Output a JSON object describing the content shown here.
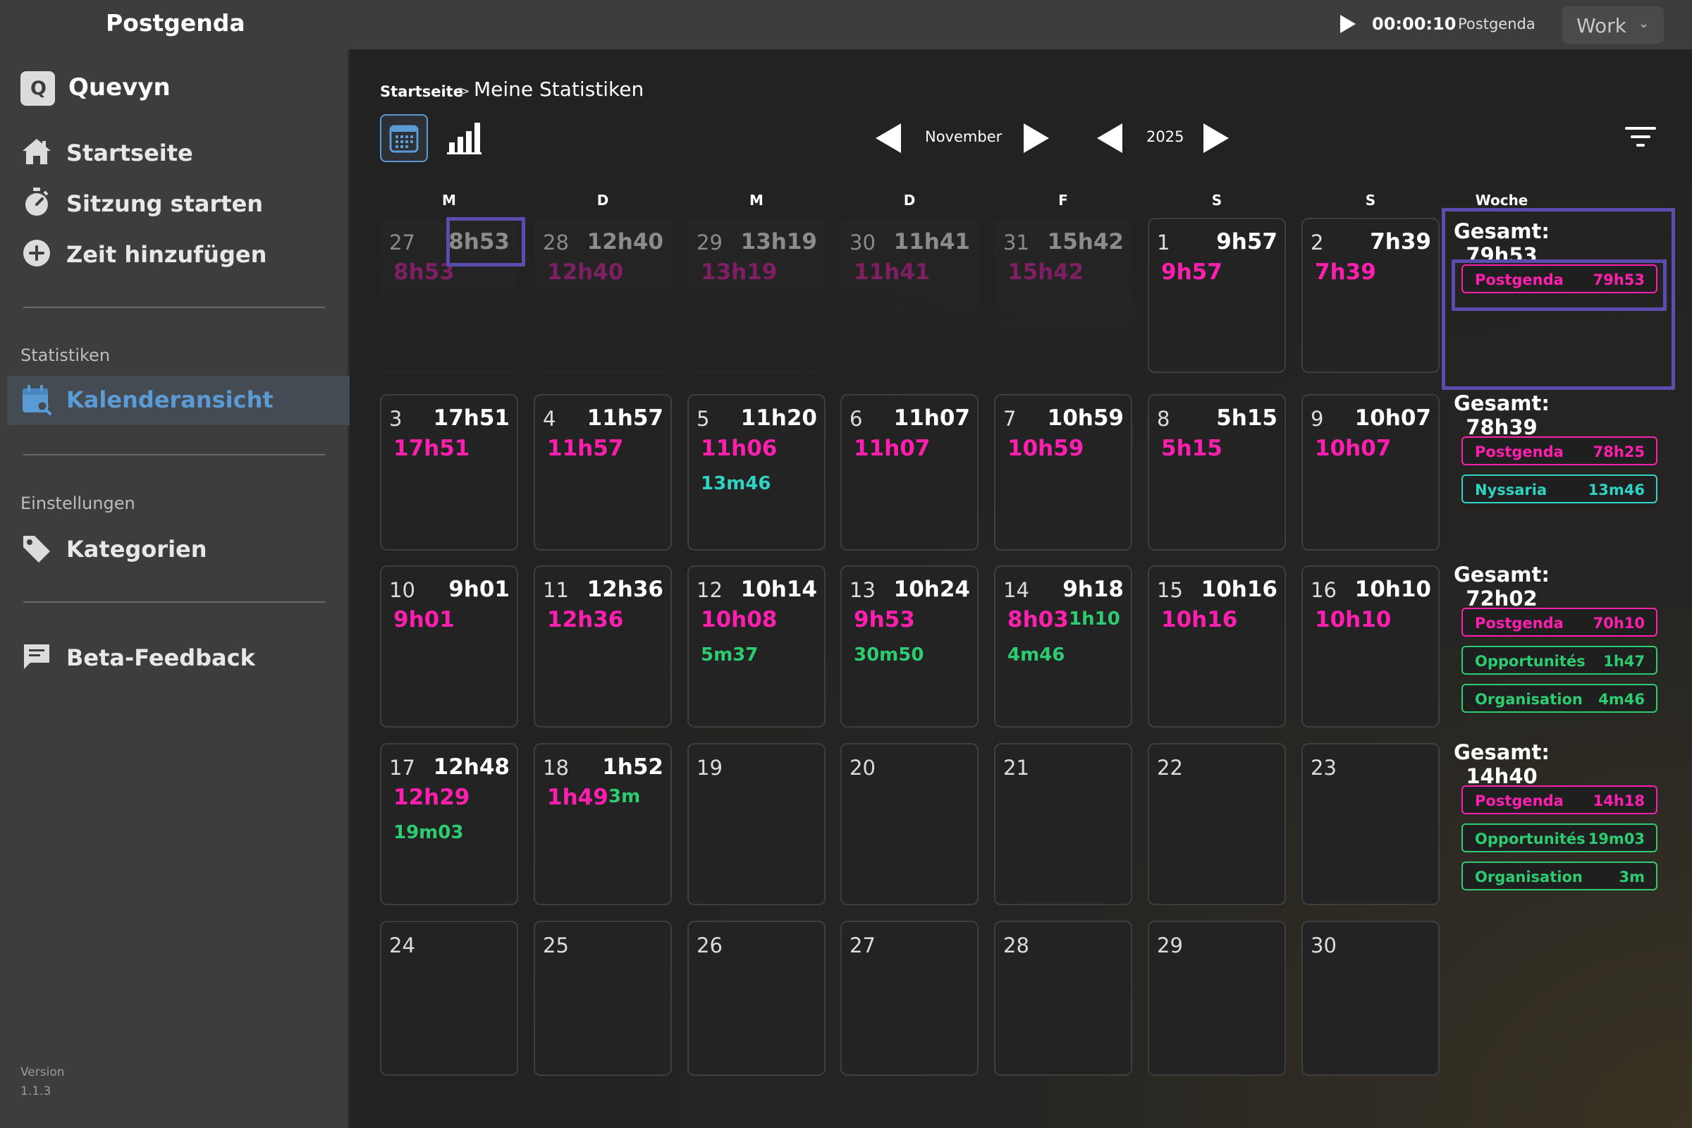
{
  "topbar": {
    "app_title": "Postgenda",
    "timer_time": "00:00:10",
    "timer_project": "Postgenda",
    "workspace": "Work"
  },
  "sidebar": {
    "brand_letter": "Q",
    "brand_name": "Quevyn",
    "nav": [
      "Startseite",
      "Sitzung starten",
      "Zeit hinzufügen"
    ],
    "section_stats": "Statistiken",
    "active_item": "Kalenderansicht",
    "section_settings": "Einstellungen",
    "settings_item": "Kategorien",
    "feedback_item": "Beta-Feedback",
    "version_label": "Version",
    "version_value": "1.1.3"
  },
  "main": {
    "breadcrumb_home": "Startseite",
    "breadcrumb_sep": ">",
    "breadcrumb_current": "Meine Statistiken",
    "month": "November",
    "year": "2025",
    "weekday_headers": [
      "M",
      "D",
      "M",
      "D",
      "F",
      "S",
      "S"
    ],
    "week_header": "Woche"
  },
  "calendar": {
    "rows": [
      [
        {
          "day": "27",
          "total": "8h53",
          "e1": "8h53",
          "outside": true
        },
        {
          "day": "28",
          "total": "12h40",
          "e1": "12h40",
          "outside": true
        },
        {
          "day": "29",
          "total": "13h19",
          "e1": "13h19",
          "outside": true
        },
        {
          "day": "30",
          "total": "11h41",
          "e1": "11h41",
          "outside": true
        },
        {
          "day": "31",
          "total": "15h42",
          "e1": "15h42",
          "outside": true
        },
        {
          "day": "1",
          "total": "9h57",
          "e1": "9h57"
        },
        {
          "day": "2",
          "total": "7h39",
          "e1": "7h39"
        }
      ],
      [
        {
          "day": "3",
          "total": "17h51",
          "e1": "17h51"
        },
        {
          "day": "4",
          "total": "11h57",
          "e1": "11h57"
        },
        {
          "day": "5",
          "total": "11h20",
          "e1": "11h06",
          "e2": "13m46",
          "e2color": "#2ed3c4",
          "e2pos": "below"
        },
        {
          "day": "6",
          "total": "11h07",
          "e1": "11h07"
        },
        {
          "day": "7",
          "total": "10h59",
          "e1": "10h59"
        },
        {
          "day": "8",
          "total": "5h15",
          "e1": "5h15"
        },
        {
          "day": "9",
          "total": "10h07",
          "e1": "10h07"
        }
      ],
      [
        {
          "day": "10",
          "total": "9h01",
          "e1": "9h01"
        },
        {
          "day": "11",
          "total": "12h36",
          "e1": "12h36"
        },
        {
          "day": "12",
          "total": "10h14",
          "e1": "10h08",
          "e2": "5m37",
          "e2color": "#2ecc71",
          "e2pos": "below"
        },
        {
          "day": "13",
          "total": "10h24",
          "e1": "9h53",
          "e2": "30m50",
          "e2color": "#2ecc71",
          "e2pos": "below"
        },
        {
          "day": "14",
          "total": "9h18",
          "e1": "8h03",
          "e2": "1h10",
          "e2color": "#2ecc71",
          "e2pos": "inline",
          "e3": "4m46",
          "e3color": "#2ecc71"
        },
        {
          "day": "15",
          "total": "10h16",
          "e1": "10h16"
        },
        {
          "day": "16",
          "total": "10h10",
          "e1": "10h10"
        }
      ],
      [
        {
          "day": "17",
          "total": "12h48",
          "e1": "12h29",
          "e2": "19m03",
          "e2color": "#2ecc71",
          "e2pos": "below"
        },
        {
          "day": "18",
          "total": "1h52",
          "e1": "1h49",
          "e2": "3m",
          "e2color": "#2ecc71",
          "e2pos": "inline"
        },
        {
          "day": "19"
        },
        {
          "day": "20"
        },
        {
          "day": "21"
        },
        {
          "day": "22"
        },
        {
          "day": "23"
        }
      ],
      [
        {
          "day": "24"
        },
        {
          "day": "25"
        },
        {
          "day": "26"
        },
        {
          "day": "27"
        },
        {
          "day": "28"
        },
        {
          "day": "29"
        },
        {
          "day": "30"
        }
      ]
    ]
  },
  "weeks": [
    {
      "total": "Gesamt: 79h53",
      "chips": [
        {
          "name": "Postgenda",
          "value": "79h53",
          "kind": "pg"
        }
      ]
    },
    {
      "total": "Gesamt: 78h39",
      "chips": [
        {
          "name": "Postgenda",
          "value": "78h25",
          "kind": "pg"
        },
        {
          "name": "Nyssaria",
          "value": "13m46",
          "kind": "ny"
        }
      ]
    },
    {
      "total": "Gesamt: 72h02",
      "chips": [
        {
          "name": "Postgenda",
          "value": "70h10",
          "kind": "pg"
        },
        {
          "name": "Opportunités",
          "value": "1h47",
          "kind": "op"
        },
        {
          "name": "Organisation",
          "value": "4m46",
          "kind": "op"
        }
      ]
    },
    {
      "total": "Gesamt: 14h40",
      "chips": [
        {
          "name": "Postgenda",
          "value": "14h18",
          "kind": "pg"
        },
        {
          "name": "Opportunités",
          "value": "19m03",
          "kind": "op"
        },
        {
          "name": "Organisation",
          "value": "3m",
          "kind": "op"
        }
      ]
    }
  ],
  "colors": {
    "postgenda": "#ff1faf",
    "opportunites": "#2ecc71",
    "nyssaria": "#2ed3c4",
    "accent": "#5b9bd5",
    "highlight": "#5a4db0"
  },
  "icons": {
    "play": "play-icon",
    "home": "home-icon",
    "stopwatch": "stopwatch-icon",
    "add": "plus-circle-icon",
    "calendar": "calendar-search-icon",
    "tag": "tag-icon",
    "feedback": "feedback-icon",
    "filter": "filter-icon",
    "calendar_view": "calendar-grid-icon",
    "chart_view": "bar-chart-icon"
  }
}
